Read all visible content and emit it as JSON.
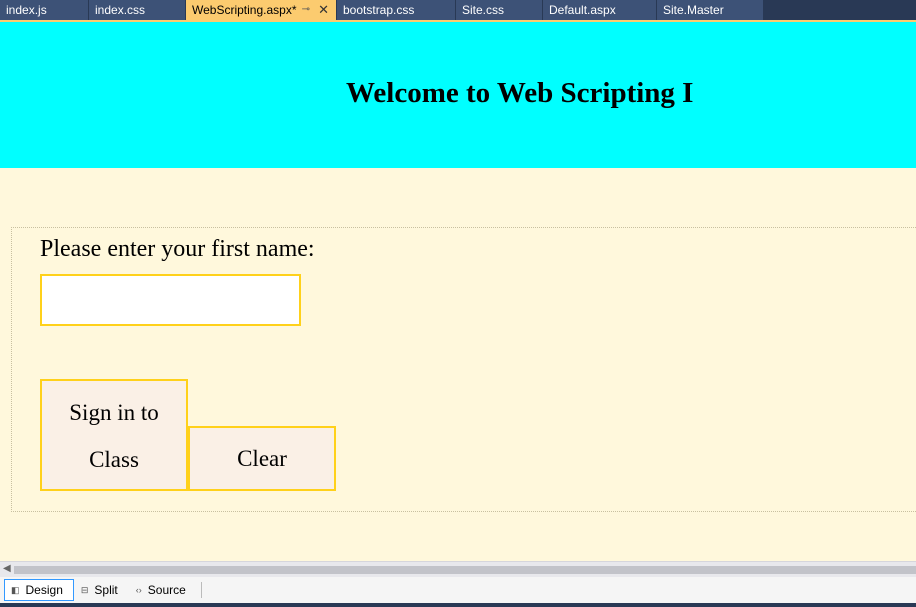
{
  "tabs": [
    {
      "label": "index.js"
    },
    {
      "label": "index.css"
    },
    {
      "label": "WebScripting.aspx*",
      "active": true
    },
    {
      "label": "bootstrap.css"
    },
    {
      "label": "Site.css"
    },
    {
      "label": "Default.aspx"
    },
    {
      "label": "Site.Master"
    }
  ],
  "tab_icons": {
    "pin": "pin-icon",
    "close": "close-icon"
  },
  "header": {
    "title": "Welcome to Web Scripting I"
  },
  "form": {
    "prompt": "Please enter your first name:",
    "name_value": "",
    "signin_line1": "Sign in to",
    "signin_line2": "Class",
    "clear_label": "Clear"
  },
  "views": [
    {
      "label": "Design",
      "icon": "design-icon",
      "active": true
    },
    {
      "label": "Split",
      "icon": "split-icon"
    },
    {
      "label": "Source",
      "icon": "source-icon"
    }
  ],
  "colors": {
    "header_bg": "#00ffff",
    "content_bg": "#fff8dc",
    "border": "#ffd11a",
    "button_bg": "#faf0e6",
    "active_tab": "#fccb6f",
    "tab_bar": "#293955"
  }
}
